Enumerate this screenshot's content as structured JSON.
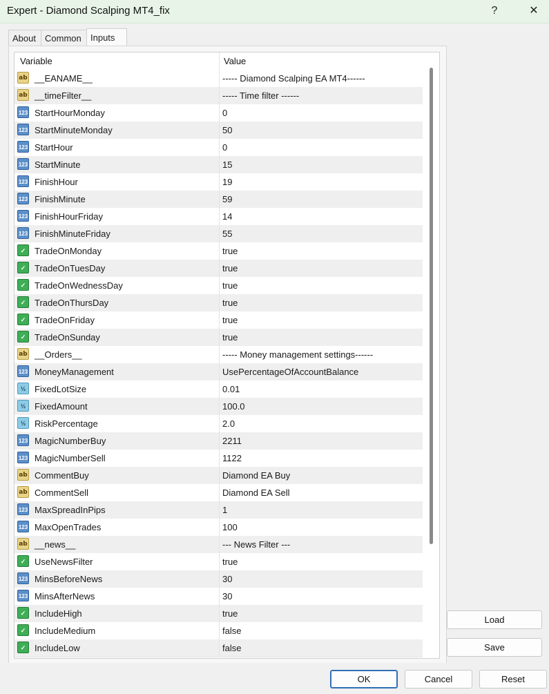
{
  "window": {
    "title": "Expert - Diamond Scalping MT4_fix",
    "help": "?",
    "close": "✕"
  },
  "tabs": [
    "About",
    "Common",
    "Inputs"
  ],
  "active_tab": "Inputs",
  "table": {
    "headers": {
      "variable": "Variable",
      "value": "Value"
    },
    "rows": [
      {
        "type": "string",
        "icon": "ab",
        "name": "__EANAME__",
        "value": "----- Diamond Scalping EA MT4------"
      },
      {
        "type": "string",
        "icon": "ab",
        "name": "__timeFilter__",
        "value": "----- Time filter ------"
      },
      {
        "type": "int",
        "icon": "123",
        "name": "StartHourMonday",
        "value": "0"
      },
      {
        "type": "int",
        "icon": "123",
        "name": "StartMinuteMonday",
        "value": "50"
      },
      {
        "type": "int",
        "icon": "123",
        "name": "StartHour",
        "value": "0"
      },
      {
        "type": "int",
        "icon": "123",
        "name": "StartMinute",
        "value": "15"
      },
      {
        "type": "int",
        "icon": "123",
        "name": "FinishHour",
        "value": "19"
      },
      {
        "type": "int",
        "icon": "123",
        "name": "FinishMinute",
        "value": "59"
      },
      {
        "type": "int",
        "icon": "123",
        "name": "FinishHourFriday",
        "value": "14"
      },
      {
        "type": "int",
        "icon": "123",
        "name": "FinishMinuteFriday",
        "value": "55"
      },
      {
        "type": "bool",
        "icon": "✓",
        "name": "TradeOnMonday",
        "value": "true"
      },
      {
        "type": "bool",
        "icon": "✓",
        "name": "TradeOnTuesDay",
        "value": "true"
      },
      {
        "type": "bool",
        "icon": "✓",
        "name": "TradeOnWednessDay",
        "value": "true"
      },
      {
        "type": "bool",
        "icon": "✓",
        "name": "TradeOnThursDay",
        "value": "true"
      },
      {
        "type": "bool",
        "icon": "✓",
        "name": "TradeOnFriday",
        "value": "true"
      },
      {
        "type": "bool",
        "icon": "✓",
        "name": "TradeOnSunday",
        "value": "true"
      },
      {
        "type": "string",
        "icon": "ab",
        "name": "__Orders__",
        "value": "----- Money management settings------"
      },
      {
        "type": "int",
        "icon": "123",
        "name": "MoneyManagement",
        "value": "UsePercentageOfAccountBalance"
      },
      {
        "type": "double",
        "icon": "½",
        "name": "FixedLotSize",
        "value": "0.01"
      },
      {
        "type": "double",
        "icon": "½",
        "name": "FixedAmount",
        "value": "100.0"
      },
      {
        "type": "double",
        "icon": "½",
        "name": "RiskPercentage",
        "value": "2.0"
      },
      {
        "type": "int",
        "icon": "123",
        "name": "MagicNumberBuy",
        "value": "2211"
      },
      {
        "type": "int",
        "icon": "123",
        "name": "MagicNumberSell",
        "value": "1122"
      },
      {
        "type": "string",
        "icon": "ab",
        "name": "CommentBuy",
        "value": "Diamond EA Buy"
      },
      {
        "type": "string",
        "icon": "ab",
        "name": "CommentSell",
        "value": "Diamond EA Sell"
      },
      {
        "type": "int",
        "icon": "123",
        "name": "MaxSpreadInPips",
        "value": "1"
      },
      {
        "type": "int",
        "icon": "123",
        "name": "MaxOpenTrades",
        "value": "100"
      },
      {
        "type": "string",
        "icon": "ab",
        "name": "__news__",
        "value": "--- News Filter ---"
      },
      {
        "type": "bool",
        "icon": "✓",
        "name": "UseNewsFilter",
        "value": "true"
      },
      {
        "type": "int",
        "icon": "123",
        "name": "MinsBeforeNews",
        "value": "30"
      },
      {
        "type": "int",
        "icon": "123",
        "name": "MinsAfterNews",
        "value": "30"
      },
      {
        "type": "bool",
        "icon": "✓",
        "name": "IncludeHigh",
        "value": "true"
      },
      {
        "type": "bool",
        "icon": "✓",
        "name": "IncludeMedium",
        "value": "false"
      },
      {
        "type": "bool",
        "icon": "✓",
        "name": "IncludeLow",
        "value": "false"
      }
    ]
  },
  "side_buttons": {
    "load": "Load",
    "save": "Save"
  },
  "footer": {
    "ok": "OK",
    "cancel": "Cancel",
    "reset": "Reset"
  }
}
